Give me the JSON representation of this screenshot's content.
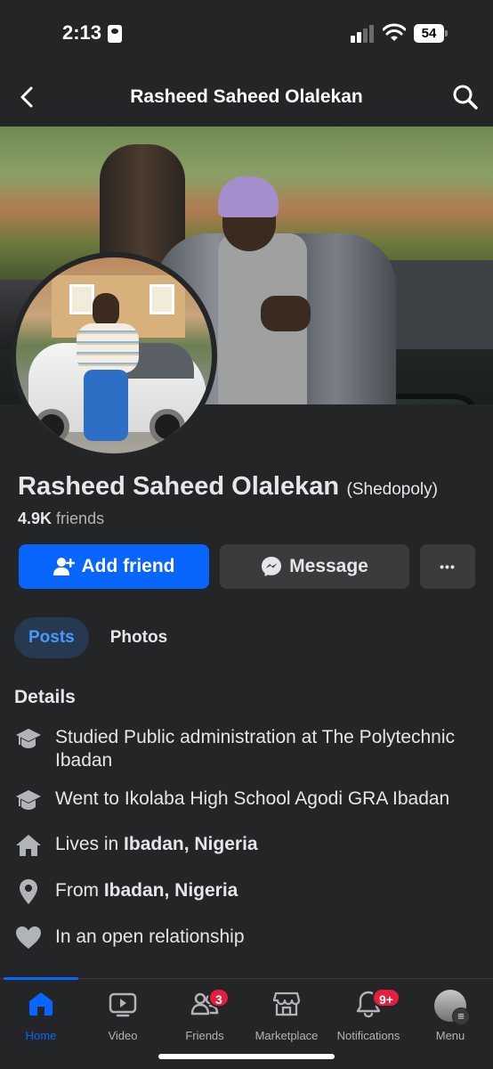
{
  "status_bar": {
    "time": "2:13",
    "battery": "54"
  },
  "header": {
    "title": "Rasheed Saheed Olalekan"
  },
  "profile": {
    "name": "Rasheed Saheed Olalekan",
    "nickname": "(Shedopoly)",
    "friends_count": "4.9K",
    "friends_label": "friends"
  },
  "actions": {
    "add_friend": "Add friend",
    "message": "Message",
    "more": "•••"
  },
  "tabs": [
    {
      "label": "Posts",
      "active": true
    },
    {
      "label": "Photos",
      "active": false
    }
  ],
  "details": {
    "title": "Details",
    "items": [
      {
        "icon": "graduation-cap-icon",
        "text": "Studied Public administration at The Polytechnic Ibadan"
      },
      {
        "icon": "graduation-cap-icon",
        "text": "Went to Ikolaba High School Agodi GRA Ibadan"
      },
      {
        "icon": "house-icon",
        "prefix": "Lives in ",
        "bold": "Ibadan, Nigeria"
      },
      {
        "icon": "location-pin-icon",
        "prefix": "From ",
        "bold": "Ibadan, Nigeria"
      },
      {
        "icon": "heart-icon",
        "text": "In an open relationship"
      }
    ]
  },
  "bottom_nav": [
    {
      "label": "Home",
      "icon": "home-icon",
      "active": true
    },
    {
      "label": "Video",
      "icon": "video-icon"
    },
    {
      "label": "Friends",
      "icon": "friends-icon",
      "badge": "3"
    },
    {
      "label": "Marketplace",
      "icon": "marketplace-icon"
    },
    {
      "label": "Notifications",
      "icon": "bell-icon",
      "badge": "9+"
    },
    {
      "label": "Menu",
      "icon": "menu-avatar-icon"
    }
  ],
  "colors": {
    "background": "#242526",
    "accent": "#0866ff",
    "badge": "#e41e3f",
    "active_tab_bg": "#263951"
  }
}
